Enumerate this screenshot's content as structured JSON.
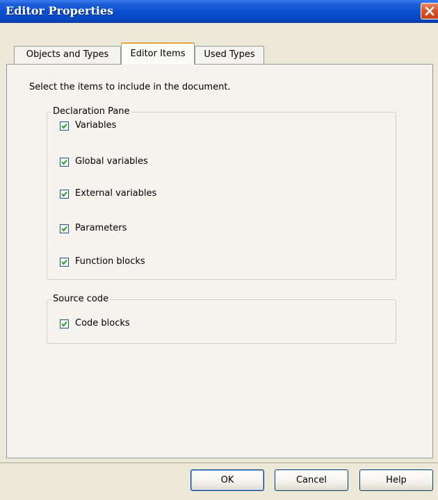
{
  "window": {
    "title": "Editor Properties"
  },
  "tabs": [
    {
      "label": "Objects and Types",
      "active": false
    },
    {
      "label": "Editor Items",
      "active": true
    },
    {
      "label": "Used Types",
      "active": false
    }
  ],
  "panel": {
    "instruction": "Select the items to include in the document.",
    "groups": [
      {
        "legend": "Declaration Pane",
        "items": [
          {
            "label": "Variables",
            "checked": true
          },
          {
            "label": "Global variables",
            "checked": true
          },
          {
            "label": "External variables",
            "checked": true
          },
          {
            "label": "Parameters",
            "checked": true
          },
          {
            "label": "Function blocks",
            "checked": true
          }
        ]
      },
      {
        "legend": "Source code",
        "items": [
          {
            "label": "Code blocks",
            "checked": true
          }
        ]
      }
    ]
  },
  "buttons": {
    "ok": "OK",
    "cancel": "Cancel",
    "help": "Help"
  },
  "icons": {
    "close": "close-icon",
    "checkmark": "checkmark-icon"
  },
  "colors": {
    "titlebar": "#0a4fd0",
    "close": "#d9552c",
    "dialog": "#ece9d8",
    "active_tab_accent": "#e6a43a"
  }
}
